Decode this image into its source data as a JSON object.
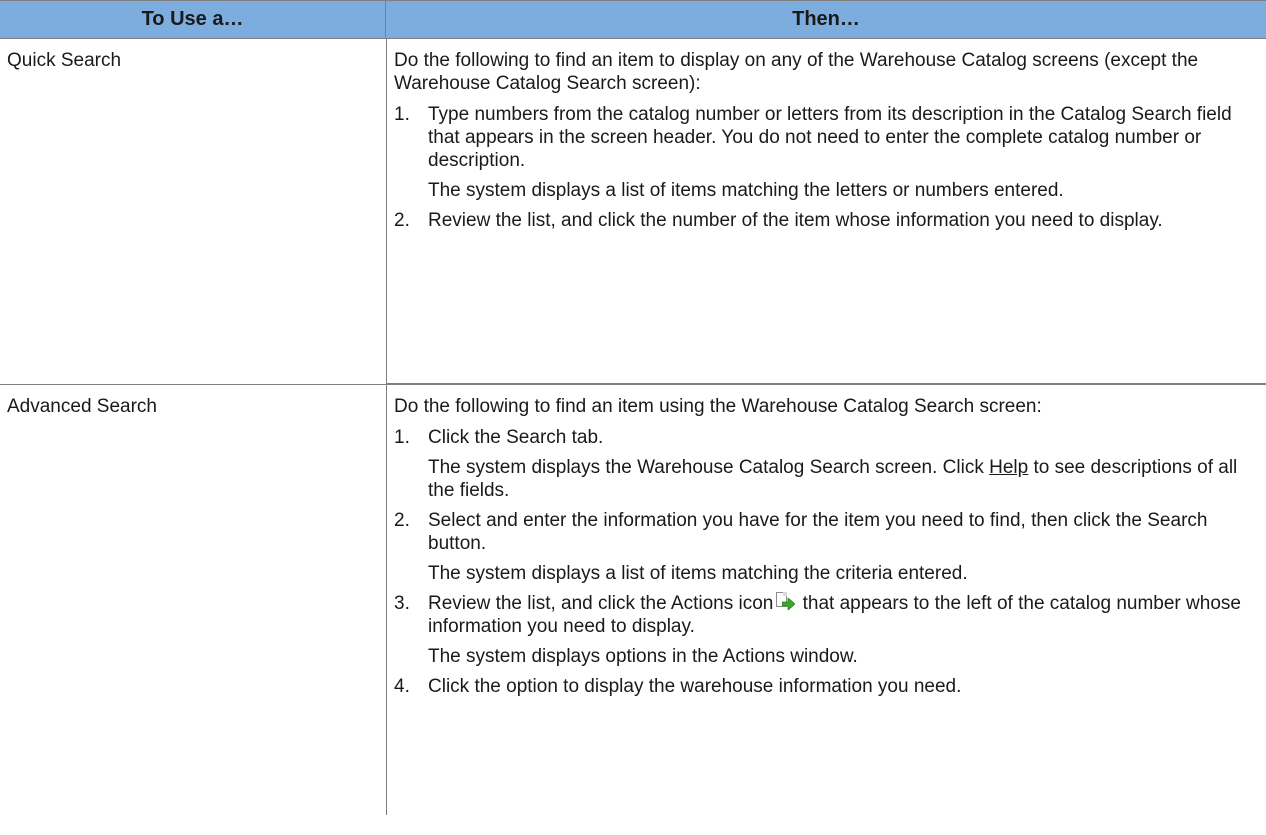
{
  "table": {
    "header": {
      "col_a": "To Use a…",
      "col_b": "Then…"
    },
    "rows": [
      {
        "label": "Quick Search",
        "intro": "Do the following to find an item to display on any of the Warehouse Catalog screens (except the Warehouse Catalog Search screen):",
        "steps": [
          {
            "num": "1.",
            "text": "Type numbers from the catalog number or letters from its description in the Catalog Search field that appears in the screen header. You do not need to enter the complete catalog number or description.",
            "note": "The system displays a list of items matching the letters or numbers entered."
          },
          {
            "num": "2.",
            "text": "Review the list, and click the number of the item whose information you need to display."
          }
        ]
      },
      {
        "label": "Advanced Search",
        "intro": "Do the following to find an item using the Warehouse Catalog Search screen:",
        "steps": [
          {
            "num": "1.",
            "text": "Click the Search tab.",
            "note_before_link": "The system displays the Warehouse Catalog Search screen. Click ",
            "note_link": "Help",
            "note_after_link": " to see descriptions of all the fields."
          },
          {
            "num": "2.",
            "text": "Select and enter the information you have for the item you need to find, then click the Search button.",
            "note": "The system displays a list of items matching the criteria entered."
          },
          {
            "num": "3.",
            "text_before_icon": "Review the list, and click the Actions icon",
            "text_after_icon": " that appears to the left of the catalog number whose information you need to display.",
            "note": "The system displays options in the Actions window."
          },
          {
            "num": "4.",
            "text": "Click the option to display the warehouse information you need."
          }
        ]
      }
    ]
  },
  "icons": {
    "actions_icon": "page-with-green-arrow-icon"
  },
  "colors": {
    "header_bg": "#7dacdf",
    "rule": "#7f7f7f",
    "icon_arrow": "#3daa2a"
  }
}
